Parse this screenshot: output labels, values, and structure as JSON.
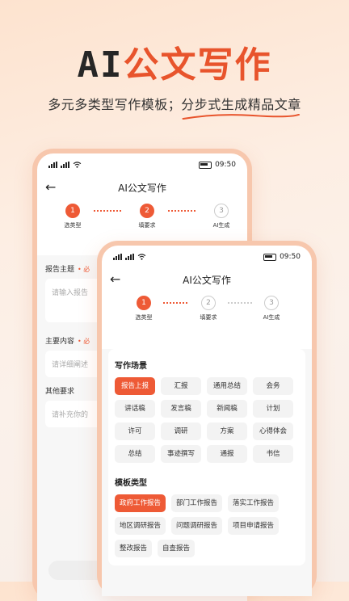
{
  "hero": {
    "title_ai": "AI",
    "title_rest": "公文写作",
    "subtitle_pre": "多元多类型写作模板；",
    "subtitle_hl": "分步式生成精品文章"
  },
  "colors": {
    "accent": "#ee5a36",
    "title_orange": "#e8542c",
    "frame": "#f7c7ad"
  },
  "status": {
    "time": "09:50",
    "signal_label": "4G",
    "icons": [
      "signal-icon",
      "wifi-icon",
      "battery-icon"
    ]
  },
  "nav": {
    "title": "AI公文写作",
    "back_icon": "back-arrow-icon"
  },
  "steps": [
    {
      "num": "1",
      "label": "选类型"
    },
    {
      "num": "2",
      "label": "填要求"
    },
    {
      "num": "3",
      "label": "AI生成"
    }
  ],
  "back_form": {
    "topic_label": "报告主题",
    "topic_req": "• 必",
    "topic_placeholder": "请输入报告",
    "content_label": "主要内容",
    "content_req": "• 必",
    "content_placeholder": "请详细阐述",
    "other_label": "其他要求",
    "other_placeholder": "请补充你的"
  },
  "scene": {
    "title": "写作场景",
    "items": [
      "报告上报",
      "汇报",
      "通用总结",
      "会务",
      "讲话稿",
      "发言稿",
      "新闻稿",
      "计划",
      "许可",
      "调研",
      "方案",
      "心得体会",
      "总结",
      "事迹撰写",
      "通报",
      "书信"
    ],
    "selected": "报告上报"
  },
  "template": {
    "title": "模板类型",
    "items": [
      "政府工作报告",
      "部门工作报告",
      "落实工作报告",
      "地区调研报告",
      "问题调研报告",
      "项目申请报告",
      "整改报告",
      "自查报告"
    ],
    "selected": "政府工作报告"
  }
}
